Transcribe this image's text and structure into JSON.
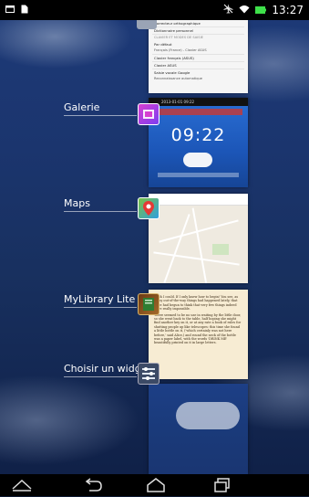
{
  "status_bar": {
    "time": "13:27",
    "icons": [
      "image-notification-icon",
      "file-notification-icon",
      "airplane-off-icon",
      "wifi-icon",
      "battery-icon"
    ]
  },
  "recent_apps": [
    {
      "label": "Galerie"
    },
    {
      "label": "Maps"
    },
    {
      "label": "MyLibrary Lite"
    },
    {
      "label": "Choisir un widget"
    }
  ],
  "settings_thumb": {
    "line1": "Correcteur orthographique",
    "line2": "Dictionnaire personnel",
    "section": "CLAVIER ET MODES DE SAISIE",
    "item_default": "Par défaut",
    "item_default_sub": "Français (France) - Clavier ASUS",
    "item_asus": "Clavier français (ASUS)",
    "item_asus2": "Clavier ASUS",
    "item_google": "Saisie vocale Google",
    "item_google_sub": "Reconnaissance automatique"
  },
  "gallery_thumb": {
    "header": "2013-01-01 09:22",
    "clock": "09:22"
  },
  "book_thumb": {
    "p1": "Sixth I could. If I only knew how to begin! You see, as many out-of-the-way things had happened lately, that Alice had begun to think that very few things indeed were really impossible.",
    "p2": "There seemed to be no use in waiting by the little door, so she went back to the table, half hoping she might find another key on it, or at any rate a book of rules for shutting people up like telescopes: this time she found a little bottle on it, ('which certainly was not here before,' said Alice,) and round the neck of the bottle was a paper label, with the words 'DRINK ME' beautifully printed on it in large letters."
  },
  "nav_bar": {
    "buttons": [
      "collapse-button",
      "back-button",
      "home-button",
      "recent-apps-button"
    ]
  }
}
